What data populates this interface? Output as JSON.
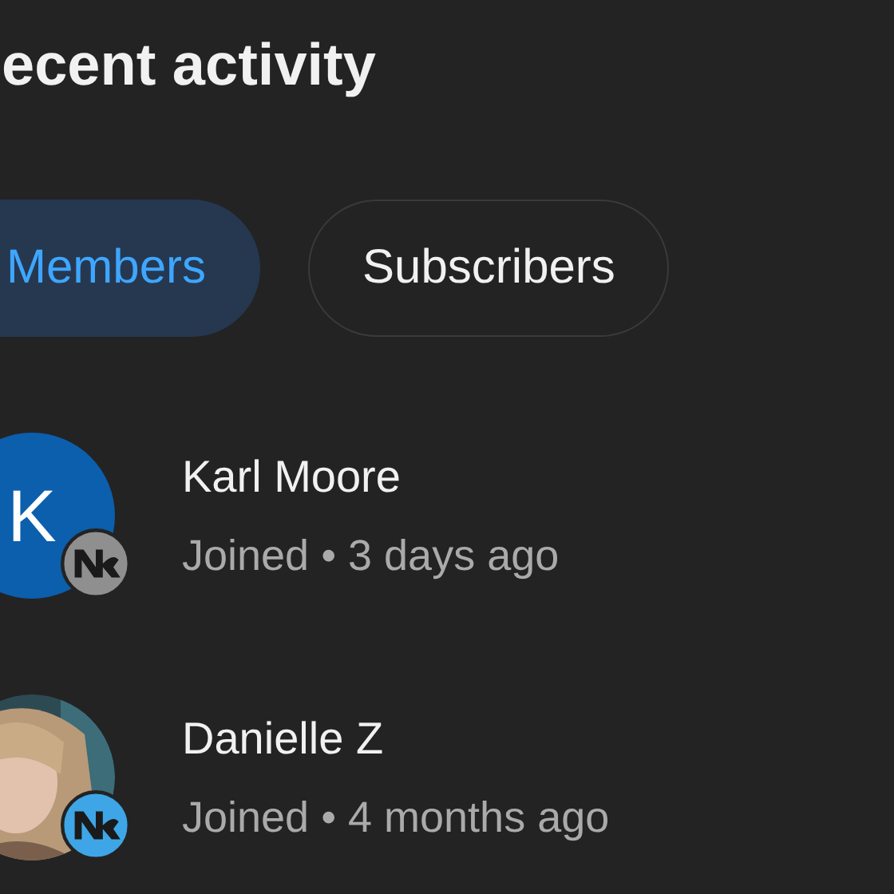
{
  "title": "ecent activity",
  "filters": [
    {
      "label": "Members",
      "selected": true
    },
    {
      "label": "Subscribers",
      "selected": false
    }
  ],
  "members": [
    {
      "name": "Karl Moore",
      "status": "Joined • 3 days ago",
      "avatar": {
        "kind": "letter",
        "letter": "K",
        "color": "#0b5fad"
      },
      "badge": {
        "color": "#8f8f8f"
      }
    },
    {
      "name": "Danielle Z",
      "status": "Joined • 4 months ago",
      "badge": {
        "color": "#3ea6e6"
      }
    }
  ]
}
